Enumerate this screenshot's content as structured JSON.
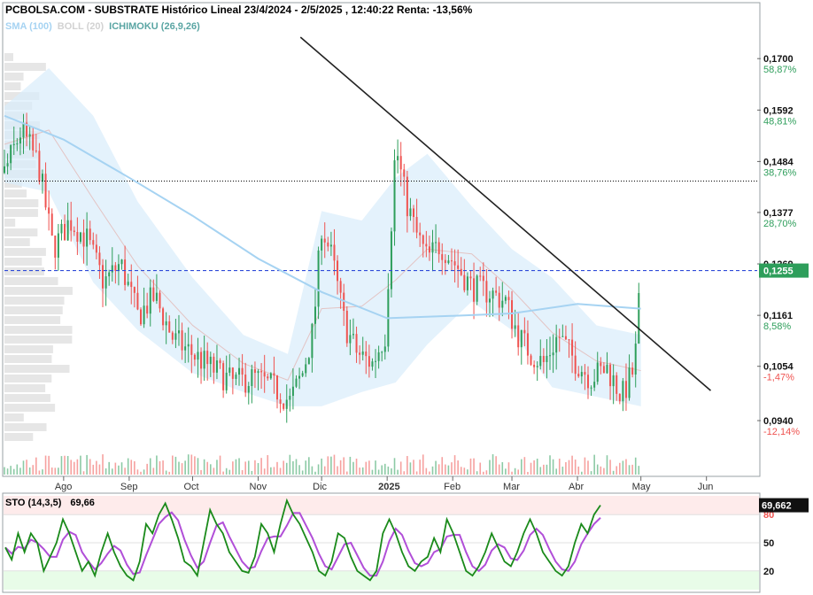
{
  "header": {
    "site": "PCBOLSA.COM",
    "dash": " - ",
    "title": "SUBSTRATE Histórico Lineal 23/4/2024 - 2/5/2025 , 12:40:22 Renta: -13,56%"
  },
  "indicators": {
    "sma": "SMA (100)",
    "boll": "BOLL (20)",
    "ichimoku": "ICHIMOKU (26,9,26)"
  },
  "stochastic": {
    "label": "STO (14,3,5)",
    "value": "69,66",
    "current_badge": "69,662",
    "levels": [
      "80",
      "50",
      "20"
    ]
  },
  "colors": {
    "up": "#2e9e5b",
    "down": "#ef5350",
    "band": "#d9edfb",
    "sma": "#a6d3f2",
    "green_pct": "#2e9e5b",
    "red_pct": "#ef5350",
    "badge": "#2e9e5b",
    "sto_k": "#1a8a1a",
    "sto_d": "#b14fd8"
  },
  "chart_data": {
    "type": "candlestick",
    "price_axis": [
      {
        "price": "0,1700",
        "pct": "58,87%",
        "v": 0.17
      },
      {
        "price": "0,1592",
        "pct": "48,81%",
        "v": 0.1592
      },
      {
        "price": "0,1484",
        "pct": "38,76%",
        "v": 0.1484
      },
      {
        "price": "0,1377",
        "pct": "28,70%",
        "v": 0.1377
      },
      {
        "price": "0,1269",
        "pct": "",
        "v": 0.1269
      },
      {
        "price": "0,1161",
        "pct": "8,58%",
        "v": 0.1161
      },
      {
        "price": "0,1054",
        "pct": "-1,47%",
        "v": 0.1054
      },
      {
        "price": "0,0940",
        "pct": "-12,14%",
        "v": 0.094
      }
    ],
    "current_price": "0,1255",
    "current_value": 0.1255,
    "reference_value": 0.1443,
    "months": [
      {
        "label": "Ago",
        "date": "2024-08-01"
      },
      {
        "label": "Sep",
        "date": "2024-09-01"
      },
      {
        "label": "Oct",
        "date": "2024-10-01"
      },
      {
        "label": "Nov",
        "date": "2024-11-01"
      },
      {
        "label": "Dic",
        "date": "2024-12-01"
      },
      {
        "label": "2025",
        "date": "2025-01-01"
      },
      {
        "label": "Feb",
        "date": "2025-02-01"
      },
      {
        "label": "Mar",
        "date": "2025-03-01"
      },
      {
        "label": "Abr",
        "date": "2025-04-01"
      },
      {
        "label": "May",
        "date": "2025-05-01"
      },
      {
        "label": "Jun",
        "date": "2025-06-01"
      }
    ],
    "x_range": [
      "2024-07-04",
      "2025-06-25"
    ],
    "y_range": [
      0.0875,
      0.1745
    ],
    "trendline": [
      {
        "date": "2024-11-21",
        "value": 0.1745
      },
      {
        "date": "2025-06-03",
        "value": 0.1003
      }
    ],
    "price_path": [
      {
        "date": "2024-07-04",
        "value": 0.146
      },
      {
        "date": "2024-07-12",
        "value": 0.155
      },
      {
        "date": "2024-07-20",
        "value": 0.148
      },
      {
        "date": "2024-07-27",
        "value": 0.13
      },
      {
        "date": "2024-08-04",
        "value": 0.136
      },
      {
        "date": "2024-08-12",
        "value": 0.132
      },
      {
        "date": "2024-08-20",
        "value": 0.123
      },
      {
        "date": "2024-08-28",
        "value": 0.127
      },
      {
        "date": "2024-09-05",
        "value": 0.116
      },
      {
        "date": "2024-09-13",
        "value": 0.12
      },
      {
        "date": "2024-09-22",
        "value": 0.111
      },
      {
        "date": "2024-10-01",
        "value": 0.108
      },
      {
        "date": "2024-10-10",
        "value": 0.105
      },
      {
        "date": "2024-10-20",
        "value": 0.102
      },
      {
        "date": "2024-10-30",
        "value": 0.103
      },
      {
        "date": "2024-11-08",
        "value": 0.101
      },
      {
        "date": "2024-11-16",
        "value": 0.098
      },
      {
        "date": "2024-11-22",
        "value": 0.104
      },
      {
        "date": "2024-11-27",
        "value": 0.113
      },
      {
        "date": "2024-12-01",
        "value": 0.135
      },
      {
        "date": "2024-12-06",
        "value": 0.128
      },
      {
        "date": "2024-12-12",
        "value": 0.114
      },
      {
        "date": "2024-12-18",
        "value": 0.108
      },
      {
        "date": "2024-12-25",
        "value": 0.106
      },
      {
        "date": "2024-12-31",
        "value": 0.112
      },
      {
        "date": "2025-01-05",
        "value": 0.152
      },
      {
        "date": "2025-01-10",
        "value": 0.14
      },
      {
        "date": "2025-01-15",
        "value": 0.133
      },
      {
        "date": "2025-01-20",
        "value": 0.128
      },
      {
        "date": "2025-01-26",
        "value": 0.131
      },
      {
        "date": "2025-02-02",
        "value": 0.127
      },
      {
        "date": "2025-02-10",
        "value": 0.122
      },
      {
        "date": "2025-02-18",
        "value": 0.121
      },
      {
        "date": "2025-02-26",
        "value": 0.119
      },
      {
        "date": "2025-03-04",
        "value": 0.112
      },
      {
        "date": "2025-03-10",
        "value": 0.108
      },
      {
        "date": "2025-03-16",
        "value": 0.106
      },
      {
        "date": "2025-03-23",
        "value": 0.112
      },
      {
        "date": "2025-03-30",
        "value": 0.107
      },
      {
        "date": "2025-04-07",
        "value": 0.103
      },
      {
        "date": "2025-04-15",
        "value": 0.105
      },
      {
        "date": "2025-04-22",
        "value": 0.099
      },
      {
        "date": "2025-04-28",
        "value": 0.105
      },
      {
        "date": "2025-05-01",
        "value": 0.1255
      }
    ],
    "sma_path": [
      {
        "date": "2024-07-04",
        "value": 0.158
      },
      {
        "date": "2024-08-01",
        "value": 0.153
      },
      {
        "date": "2024-09-01",
        "value": 0.145
      },
      {
        "date": "2024-10-01",
        "value": 0.137
      },
      {
        "date": "2024-11-01",
        "value": 0.128
      },
      {
        "date": "2024-12-01",
        "value": 0.121
      },
      {
        "date": "2025-01-01",
        "value": 0.1155
      },
      {
        "date": "2025-02-01",
        "value": 0.116
      },
      {
        "date": "2025-03-01",
        "value": 0.1165
      },
      {
        "date": "2025-04-01",
        "value": 0.1185
      },
      {
        "date": "2025-05-01",
        "value": 0.1175
      }
    ],
    "bands": [
      {
        "date": "2024-07-04",
        "upper": 0.16,
        "lower": 0.144
      },
      {
        "date": "2024-07-25",
        "upper": 0.168,
        "lower": 0.142
      },
      {
        "date": "2024-08-15",
        "upper": 0.158,
        "lower": 0.123
      },
      {
        "date": "2024-09-05",
        "upper": 0.14,
        "lower": 0.113
      },
      {
        "date": "2024-10-01",
        "upper": 0.124,
        "lower": 0.104
      },
      {
        "date": "2024-10-25",
        "upper": 0.112,
        "lower": 0.1
      },
      {
        "date": "2024-11-15",
        "upper": 0.108,
        "lower": 0.097
      },
      {
        "date": "2024-12-01",
        "upper": 0.138,
        "lower": 0.097
      },
      {
        "date": "2024-12-20",
        "upper": 0.136,
        "lower": 0.1
      },
      {
        "date": "2025-01-05",
        "upper": 0.145,
        "lower": 0.102
      },
      {
        "date": "2025-01-20",
        "upper": 0.15,
        "lower": 0.11
      },
      {
        "date": "2025-02-10",
        "upper": 0.139,
        "lower": 0.119
      },
      {
        "date": "2025-03-01",
        "upper": 0.13,
        "lower": 0.113
      },
      {
        "date": "2025-03-20",
        "upper": 0.124,
        "lower": 0.101
      },
      {
        "date": "2025-04-10",
        "upper": 0.114,
        "lower": 0.099
      },
      {
        "date": "2025-05-01",
        "upper": 0.112,
        "lower": 0.097
      }
    ],
    "stochastic_k": [
      45,
      32,
      60,
      40,
      60,
      50,
      20,
      35,
      50,
      75,
      60,
      40,
      20,
      30,
      15,
      40,
      60,
      40,
      25,
      15,
      10,
      30,
      70,
      60,
      80,
      92,
      75,
      55,
      30,
      25,
      15,
      50,
      85,
      70,
      60,
      40,
      30,
      20,
      18,
      35,
      70,
      60,
      40,
      70,
      95,
      80,
      70,
      55,
      40,
      20,
      15,
      30,
      60,
      55,
      35,
      20,
      15,
      10,
      20,
      60,
      75,
      60,
      40,
      25,
      20,
      30,
      35,
      55,
      40,
      75,
      60,
      40,
      20,
      15,
      25,
      40,
      60,
      45,
      30,
      25,
      40,
      60,
      75,
      60,
      40,
      30,
      20,
      15,
      25,
      50,
      70,
      60,
      80,
      90
    ]
  }
}
